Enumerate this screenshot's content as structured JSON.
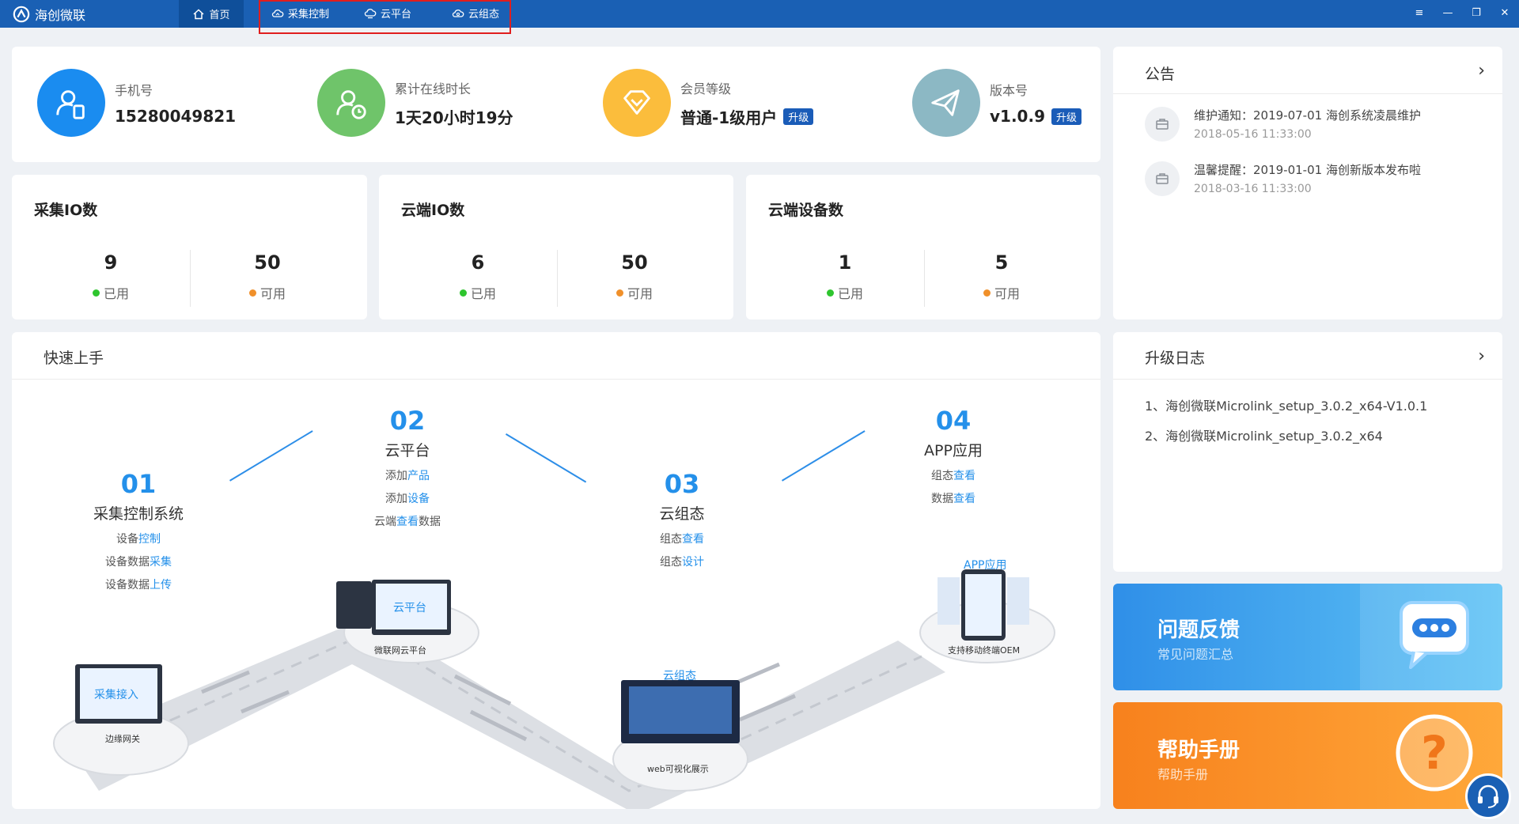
{
  "app": {
    "name": "海创微联"
  },
  "nav": {
    "home": "首页",
    "items": [
      {
        "label": "采集控制",
        "icon": "cloud-collect-icon"
      },
      {
        "label": "云平台",
        "icon": "cloud-platform-icon"
      },
      {
        "label": "云组态",
        "icon": "cloud-config-icon"
      }
    ]
  },
  "window": {
    "menu": "≡",
    "minimize": "—",
    "maximize": "❐",
    "close": "✕"
  },
  "stats": [
    {
      "label": "手机号",
      "value": "15280049821",
      "icon": "user-phone-icon",
      "color": "#1a8cf0"
    },
    {
      "label": "累计在线时长",
      "value": "1天20小时19分",
      "icon": "user-clock-icon",
      "color": "#6fc46a"
    },
    {
      "label": "会员等级",
      "value": "普通-1级用户",
      "badge": "升级",
      "icon": "diamond-icon",
      "color": "#fbbd3c"
    },
    {
      "label": "版本号",
      "value": "v1.0.9",
      "badge": "升级",
      "icon": "paper-plane-icon",
      "color": "#8cb8c4"
    }
  ],
  "io_cards": [
    {
      "title": "采集IO数",
      "used": "9",
      "used_label": "已用",
      "available": "50",
      "available_label": "可用"
    },
    {
      "title": "云端IO数",
      "used": "6",
      "used_label": "已用",
      "available": "50",
      "available_label": "可用"
    },
    {
      "title": "云端设备数",
      "used": "1",
      "used_label": "已用",
      "available": "5",
      "available_label": "可用"
    }
  ],
  "status_colors": {
    "used": "#2ec52e",
    "available": "#f0902a"
  },
  "notice": {
    "title": "公告",
    "items": [
      {
        "title": "维护通知：2019-07-01 海创系统凌晨维护",
        "time": "2018-05-16 11:33:00"
      },
      {
        "title": "温馨提醒：2019-01-01 海创新版本发布啦",
        "time": "2018-03-16 11:33:00"
      }
    ]
  },
  "quick_start": {
    "title": "快速上手",
    "steps": [
      {
        "num": "01",
        "title": "采集控制系统",
        "lines": [
          [
            "设备",
            "控制"
          ],
          [
            "设备数据",
            "采集"
          ],
          [
            "设备数据",
            "上传"
          ]
        ]
      },
      {
        "num": "02",
        "title": "云平台",
        "lines": [
          [
            "添加",
            "产品"
          ],
          [
            "添加",
            "设备"
          ],
          [
            "云端",
            "查看",
            "数据"
          ]
        ]
      },
      {
        "num": "03",
        "title": "云组态",
        "lines": [
          [
            "组态",
            "查看"
          ],
          [
            "组态",
            "设计"
          ]
        ]
      },
      {
        "num": "04",
        "title": "APP应用",
        "lines": [
          [
            "组态",
            "查看"
          ],
          [
            "数据",
            "查看"
          ]
        ]
      }
    ],
    "illustration": {
      "platform_labels": [
        "边缘网关",
        "微联网云平台",
        "web可视化展示",
        "支持移动终端OEM"
      ],
      "screen_labels": [
        "采集接入",
        "云平台",
        "云组态",
        "APP应用"
      ]
    }
  },
  "upgrade_log": {
    "title": "升级日志",
    "items": [
      "1、海创微联Microlink_setup_3.0.2_x64-V1.0.1",
      "2、海创微联Microlink_setup_3.0.2_x64"
    ]
  },
  "feedback": {
    "title": "问题反馈",
    "subtitle": "常见问题汇总"
  },
  "help": {
    "title": "帮助手册",
    "subtitle": "帮助手册"
  }
}
